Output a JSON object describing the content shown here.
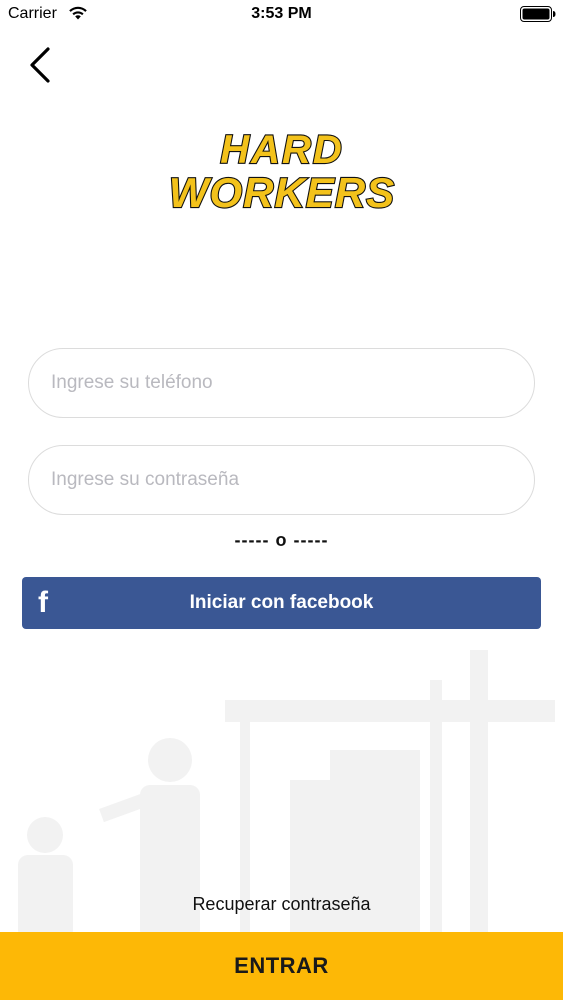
{
  "status_bar": {
    "carrier": "Carrier",
    "time": "3:53 PM"
  },
  "nav": {
    "back_icon": "chevron-left-icon"
  },
  "logo": {
    "line1": "HARD",
    "line2": "WORKERS",
    "fill_color": "#f3c21b",
    "outline_color": "#111111"
  },
  "form": {
    "phone_placeholder": "Ingrese su teléfono",
    "password_placeholder": "Ingrese su contraseña",
    "divider_text": "----- o -----"
  },
  "facebook": {
    "icon_glyph": "f",
    "label": "Iniciar con facebook",
    "color": "#3a5794"
  },
  "recover_link": "Recuperar contraseña",
  "enter_button": {
    "label": "ENTRAR",
    "color": "#fdb806"
  }
}
